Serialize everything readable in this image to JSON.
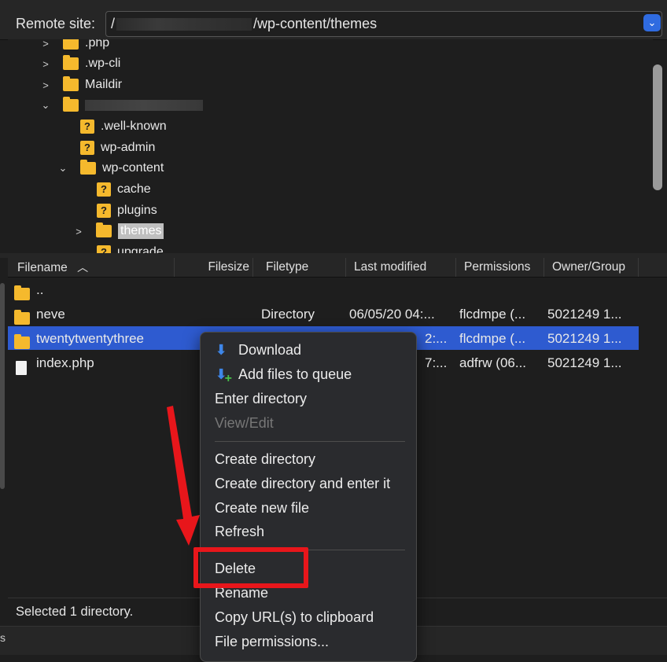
{
  "remote": {
    "label": "Remote site:",
    "path_prefix": "/",
    "path_suffix": "/wp-content/themes"
  },
  "tree": [
    {
      "name": ".php",
      "arrow": ">",
      "icon": "folder-icon"
    },
    {
      "name": ".wp-cli",
      "arrow": ">",
      "icon": "folder-icon"
    },
    {
      "name": "Maildir",
      "arrow": ">",
      "icon": "folder-icon"
    },
    {
      "name": "",
      "arrow": "v",
      "icon": "folder-icon"
    },
    {
      "name": ".well-known",
      "arrow": "",
      "icon": "unknown-folder-icon"
    },
    {
      "name": "wp-admin",
      "arrow": "",
      "icon": "unknown-folder-icon"
    },
    {
      "name": "wp-content",
      "arrow": "v",
      "icon": "folder-icon"
    },
    {
      "name": "cache",
      "arrow": "",
      "icon": "unknown-folder-icon"
    },
    {
      "name": "plugins",
      "arrow": "",
      "icon": "unknown-folder-icon"
    },
    {
      "name": "themes",
      "arrow": ">",
      "icon": "folder-icon"
    },
    {
      "name": "upgrade",
      "arrow": "",
      "icon": "unknown-folder-icon"
    }
  ],
  "columns": [
    "Filename",
    "Filesize",
    "Filetype",
    "Last modified",
    "Permissions",
    "Owner/Group"
  ],
  "files": [
    {
      "name": "..",
      "type": "",
      "modified": "",
      "perms": "",
      "owner": ""
    },
    {
      "name": "neve",
      "type": "Directory",
      "modified": "06/05/20 04:...",
      "perms": "flcdmpe (...",
      "owner": "5021249 1..."
    },
    {
      "name": "twentytwentythree",
      "type": "",
      "modified": "2:...",
      "perms": "flcdmpe (...",
      "owner": "5021249 1..."
    },
    {
      "name": "index.php",
      "type": "",
      "modified": "7:...",
      "perms": "adfrw (06...",
      "owner": "5021249 1..."
    }
  ],
  "status": "Selected 1 directory.",
  "bottom_fragment": "s",
  "menu": {
    "download": "Download",
    "add_to_queue": "Add files to queue",
    "enter_directory": "Enter directory",
    "view_edit": "View/Edit",
    "create_directory": "Create directory",
    "create_directory_enter": "Create directory and enter it",
    "create_new_file": "Create new file",
    "refresh": "Refresh",
    "delete": "Delete",
    "rename": "Rename",
    "copy_url": "Copy URL(s) to clipboard",
    "file_permissions": "File permissions..."
  },
  "colors": {
    "selection": "#2e5bd0",
    "highlight_annotation": "#e8161b",
    "folder": "#f5b92d"
  }
}
